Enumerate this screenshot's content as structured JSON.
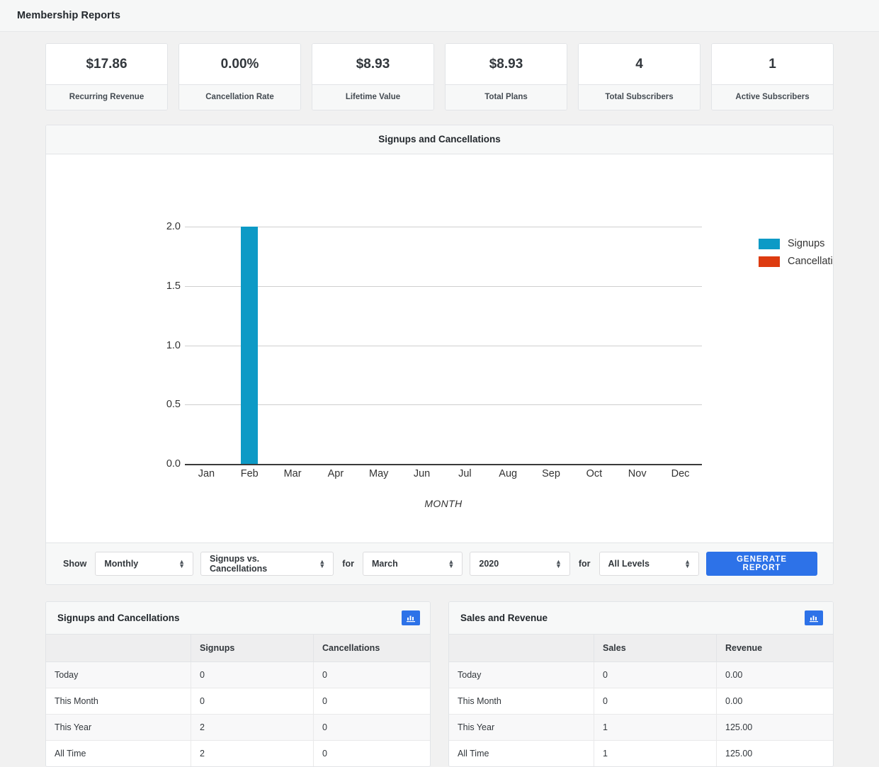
{
  "header": {
    "title": "Membership Reports"
  },
  "stats": [
    {
      "value": "$17.86",
      "label": "Recurring Revenue"
    },
    {
      "value": "0.00%",
      "label": "Cancellation Rate"
    },
    {
      "value": "$8.93",
      "label": "Lifetime Value"
    },
    {
      "value": "$8.93",
      "label": "Total Plans"
    },
    {
      "value": "4",
      "label": "Total Subscribers"
    },
    {
      "value": "1",
      "label": "Active Subscribers"
    }
  ],
  "chart_panel": {
    "title": "Signups and Cancellations"
  },
  "chart_data": {
    "type": "bar",
    "title": "Signups and Cancellations",
    "categories": [
      "Jan",
      "Feb",
      "Mar",
      "Apr",
      "May",
      "Jun",
      "Jul",
      "Aug",
      "Sep",
      "Oct",
      "Nov",
      "Dec"
    ],
    "series": [
      {
        "name": "Signups",
        "color": "#0d9ac6",
        "values": [
          0,
          2,
          0,
          0,
          0,
          0,
          0,
          0,
          0,
          0,
          0,
          0
        ]
      },
      {
        "name": "Cancellations",
        "color": "#dd3b10",
        "values": [
          0,
          0,
          0,
          0,
          0,
          0,
          0,
          0,
          0,
          0,
          0,
          0
        ]
      }
    ],
    "xlabel": "MONTH",
    "ylabel": "",
    "yticks": [
      "2.0",
      "1.5",
      "1.0",
      "0.5",
      "0.0"
    ],
    "ylim": [
      0,
      2
    ],
    "grid": true,
    "legend_position": "right"
  },
  "controls": {
    "show_label": "Show",
    "for_label_1": "for",
    "for_label_2": "for",
    "period": "Monthly",
    "report_type": "Signups vs. Cancellations",
    "month": "March",
    "year": "2020",
    "level": "All Levels",
    "generate_label": "GENERATE REPORT"
  },
  "tables": [
    {
      "title": "Signups and Cancellations",
      "chart_icon": "bar-chart-icon",
      "columns": [
        "",
        "Signups",
        "Cancellations"
      ],
      "rows": [
        [
          "Today",
          "0",
          "0"
        ],
        [
          "This Month",
          "0",
          "0"
        ],
        [
          "This Year",
          "2",
          "0"
        ],
        [
          "All Time",
          "2",
          "0"
        ]
      ]
    },
    {
      "title": "Sales and Revenue",
      "chart_icon": "bar-chart-icon",
      "columns": [
        "",
        "Sales",
        "Revenue"
      ],
      "rows": [
        [
          "Today",
          "0",
          "0.00"
        ],
        [
          "This Month",
          "0",
          "0.00"
        ],
        [
          "This Year",
          "1",
          "125.00"
        ],
        [
          "All Time",
          "1",
          "125.00"
        ]
      ]
    }
  ],
  "colors": {
    "accent_blue": "#2d72e8",
    "signups": "#0d9ac6",
    "cancellations": "#dd3b10",
    "page_bg": "#f1f1f1"
  }
}
